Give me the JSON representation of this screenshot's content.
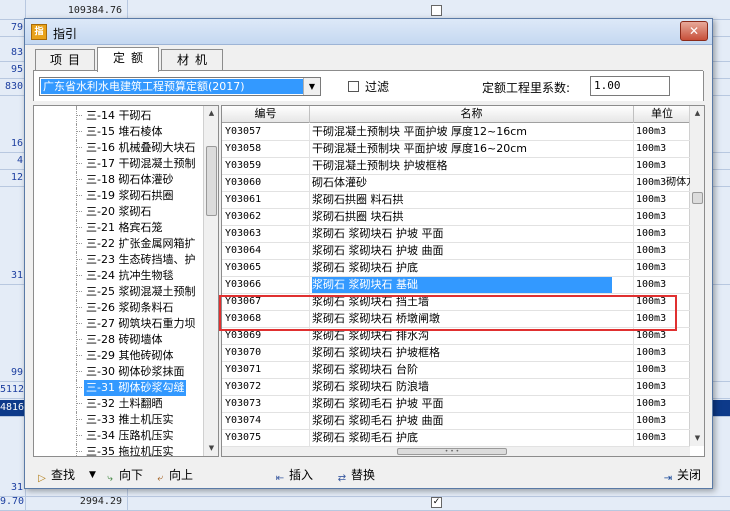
{
  "background": {
    "rows": [
      {
        "a": "",
        "b": "109384.76"
      },
      {
        "a": "79",
        "b": ""
      },
      {
        "a": "83",
        "b": ""
      },
      {
        "a": "95",
        "b": ""
      },
      {
        "a": "830",
        "b": ""
      },
      {
        "a": "16",
        "b": ""
      },
      {
        "a": "4",
        "b": ""
      },
      {
        "a": "12",
        "b": ""
      },
      {
        "a": "31",
        "b": ""
      },
      {
        "a": "99",
        "b": ""
      },
      {
        "a": "5112",
        "b": ""
      },
      {
        "a": "4816",
        "b": ""
      },
      {
        "a": "31",
        "b": ""
      },
      {
        "a": "9.70",
        "b": "2994.29"
      }
    ]
  },
  "dialog": {
    "title": "指引",
    "close_symbol": "✕",
    "icon_text": "指",
    "tabs": [
      {
        "label": "项目",
        "active": false
      },
      {
        "label": "定额",
        "active": true
      },
      {
        "label": "材机",
        "active": false
      }
    ],
    "standard": {
      "selected": "广东省水利水电建筑工程预算定额(2017)"
    },
    "filter": {
      "label": "过滤",
      "checked": false
    },
    "coefficient": {
      "label": "定额工程里系数:",
      "value": "1.00"
    },
    "tree": {
      "items": [
        {
          "label": "三-14 干砌石",
          "selected": false
        },
        {
          "label": "三-15 堆石棱体",
          "selected": false
        },
        {
          "label": "三-16 机械叠砌大块石",
          "selected": false
        },
        {
          "label": "三-17 干砌混凝土预制",
          "selected": false
        },
        {
          "label": "三-18 砌石体灌砂",
          "selected": false
        },
        {
          "label": "三-19 浆砌石拱圈",
          "selected": false
        },
        {
          "label": "三-20 浆砌石",
          "selected": false
        },
        {
          "label": "三-21 格宾石笼",
          "selected": false
        },
        {
          "label": "三-22 扩张金属网箱扩",
          "selected": false
        },
        {
          "label": "三-23 生态砖挡墙、护",
          "selected": false
        },
        {
          "label": "三-24 抗冲生物毯",
          "selected": false
        },
        {
          "label": "三-25 浆砌混凝土预制",
          "selected": false
        },
        {
          "label": "三-26 浆砌条料石",
          "selected": false
        },
        {
          "label": "三-27 砌筑块石重力坝",
          "selected": false
        },
        {
          "label": "三-28 砖砌墙体",
          "selected": false
        },
        {
          "label": "三-29 其他砖砌体",
          "selected": false
        },
        {
          "label": "三-30 砌体砂浆抹面",
          "selected": false
        },
        {
          "label": "三-31 砌体砂浆勾缝",
          "selected": true
        },
        {
          "label": "三-32 土料翻晒",
          "selected": false
        },
        {
          "label": "三-33 推土机压实",
          "selected": false
        },
        {
          "label": "三-34 压路机压实",
          "selected": false
        },
        {
          "label": "三-35 拖拉机压实",
          "selected": false
        }
      ]
    },
    "grid": {
      "headers": {
        "code": "编号",
        "name": "名称",
        "unit": "单位"
      },
      "rows": [
        {
          "code": "Y03057",
          "name": "干砌混凝土预制块 平面护坡 厚度12~16cm",
          "unit": "100m3",
          "selected": false
        },
        {
          "code": "Y03058",
          "name": "干砌混凝土预制块 平面护坡 厚度16~20cm",
          "unit": "100m3",
          "selected": false
        },
        {
          "code": "Y03059",
          "name": "干砌混凝土预制块 护坡框格",
          "unit": "100m3",
          "selected": false
        },
        {
          "code": "Y03060",
          "name": "砌石体灌砂",
          "unit": "100m3砌体方",
          "selected": false
        },
        {
          "code": "Y03061",
          "name": "浆砌石拱圈 料石拱",
          "unit": "100m3",
          "selected": false
        },
        {
          "code": "Y03062",
          "name": "浆砌石拱圈 块石拱",
          "unit": "100m3",
          "selected": false
        },
        {
          "code": "Y03063",
          "name": "浆砌石 浆砌块石 护坡 平面",
          "unit": "100m3",
          "selected": false
        },
        {
          "code": "Y03064",
          "name": "浆砌石 浆砌块石 护坡 曲面",
          "unit": "100m3",
          "selected": false
        },
        {
          "code": "Y03065",
          "name": "浆砌石 浆砌块石 护底",
          "unit": "100m3",
          "selected": false
        },
        {
          "code": "Y03066",
          "name": "浆砌石 浆砌块石 基础",
          "unit": "100m3",
          "selected": true
        },
        {
          "code": "Y03067",
          "name": "浆砌石 浆砌块石 挡土墙",
          "unit": "100m3",
          "selected": false
        },
        {
          "code": "Y03068",
          "name": "浆砌石 浆砌块石 桥墩闸墩",
          "unit": "100m3",
          "selected": false
        },
        {
          "code": "Y03069",
          "name": "浆砌石 浆砌块石 排水沟",
          "unit": "100m3",
          "selected": false
        },
        {
          "code": "Y03070",
          "name": "浆砌石 浆砌块石 护坡框格",
          "unit": "100m3",
          "selected": false
        },
        {
          "code": "Y03071",
          "name": "浆砌石 浆砌块石 台阶",
          "unit": "100m3",
          "selected": false
        },
        {
          "code": "Y03072",
          "name": "浆砌石 浆砌块石 防浪墙",
          "unit": "100m3",
          "selected": false
        },
        {
          "code": "Y03073",
          "name": "浆砌石 浆砌毛石 护坡 平面",
          "unit": "100m3",
          "selected": false
        },
        {
          "code": "Y03074",
          "name": "浆砌石 浆砌毛石 护坡 曲面",
          "unit": "100m3",
          "selected": false
        },
        {
          "code": "Y03075",
          "name": "浆砌石 浆砌毛石 护底",
          "unit": "100m3",
          "selected": false
        }
      ]
    },
    "toolbar": {
      "find": "查找",
      "find_dropdown": "▼",
      "down": "向下",
      "up": "向上",
      "insert": "插入",
      "replace": "替换",
      "close": "关闭"
    }
  }
}
